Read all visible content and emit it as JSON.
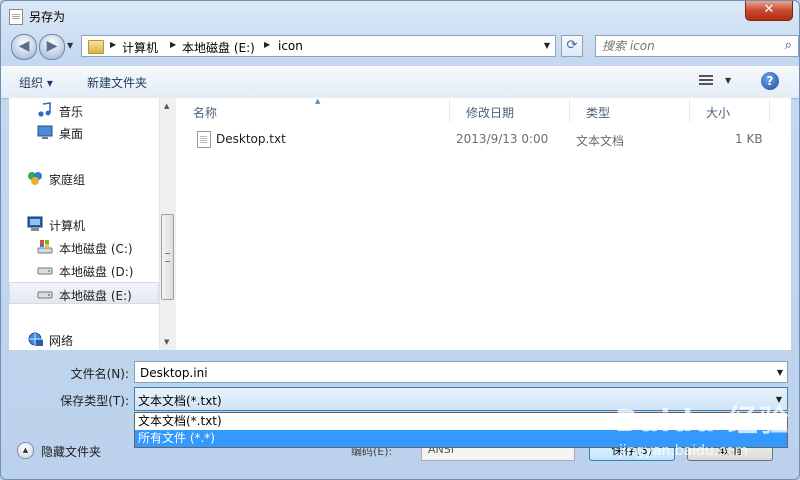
{
  "window": {
    "title": "另存为",
    "close_glyph": "✕"
  },
  "nav": {
    "back_glyph": "◀",
    "forward_glyph": "▶",
    "breadcrumbs": [
      "计算机",
      "本地磁盘 (E:)",
      "icon"
    ],
    "search_placeholder": "搜索 icon"
  },
  "toolbar": {
    "organize_label": "组织 ▾",
    "new_folder_label": "新建文件夹",
    "help_label": "?"
  },
  "nav_pane": {
    "items": [
      {
        "label": "音乐",
        "icon": "music-icon"
      },
      {
        "label": "桌面",
        "icon": "desktop-icon"
      },
      {
        "label": "家庭组",
        "icon": "homegroup-icon"
      },
      {
        "label": "计算机",
        "icon": "computer-icon"
      },
      {
        "label": "本地磁盘 (C:)",
        "icon": "drive-windows-icon"
      },
      {
        "label": "本地磁盘 (D:)",
        "icon": "drive-icon"
      },
      {
        "label": "本地磁盘 (E:)",
        "icon": "drive-icon",
        "selected": true
      },
      {
        "label": "网络",
        "icon": "network-icon"
      }
    ]
  },
  "file_list": {
    "columns": [
      "名称",
      "修改日期",
      "类型",
      "大小"
    ],
    "rows": [
      {
        "name": "Desktop.txt",
        "date": "2013/9/13 0:00",
        "type": "文本文档",
        "size": "1 KB"
      }
    ]
  },
  "form": {
    "filename_label": "文件名(N):",
    "filename_value": "Desktop.ini",
    "filetype_label": "保存类型(T):",
    "filetype_value": "文本文档(*.txt)",
    "filetype_options": [
      "文本文档(*.txt)",
      "所有文件  (*.*)"
    ],
    "highlighted_option_index": 1
  },
  "footer": {
    "hide_folders_label": "隐藏文件夹",
    "encoding_label": "编码(E):",
    "encoding_value": "ANSI",
    "save_label": "保存(S)",
    "cancel_label": "取消"
  },
  "watermark": {
    "brand": "Baidu 经验",
    "url": "jingyan.baidu.com"
  },
  "colors": {
    "accent": "#3399ff",
    "titlebar": "#c4d8ef",
    "close": "#c74a2f"
  }
}
